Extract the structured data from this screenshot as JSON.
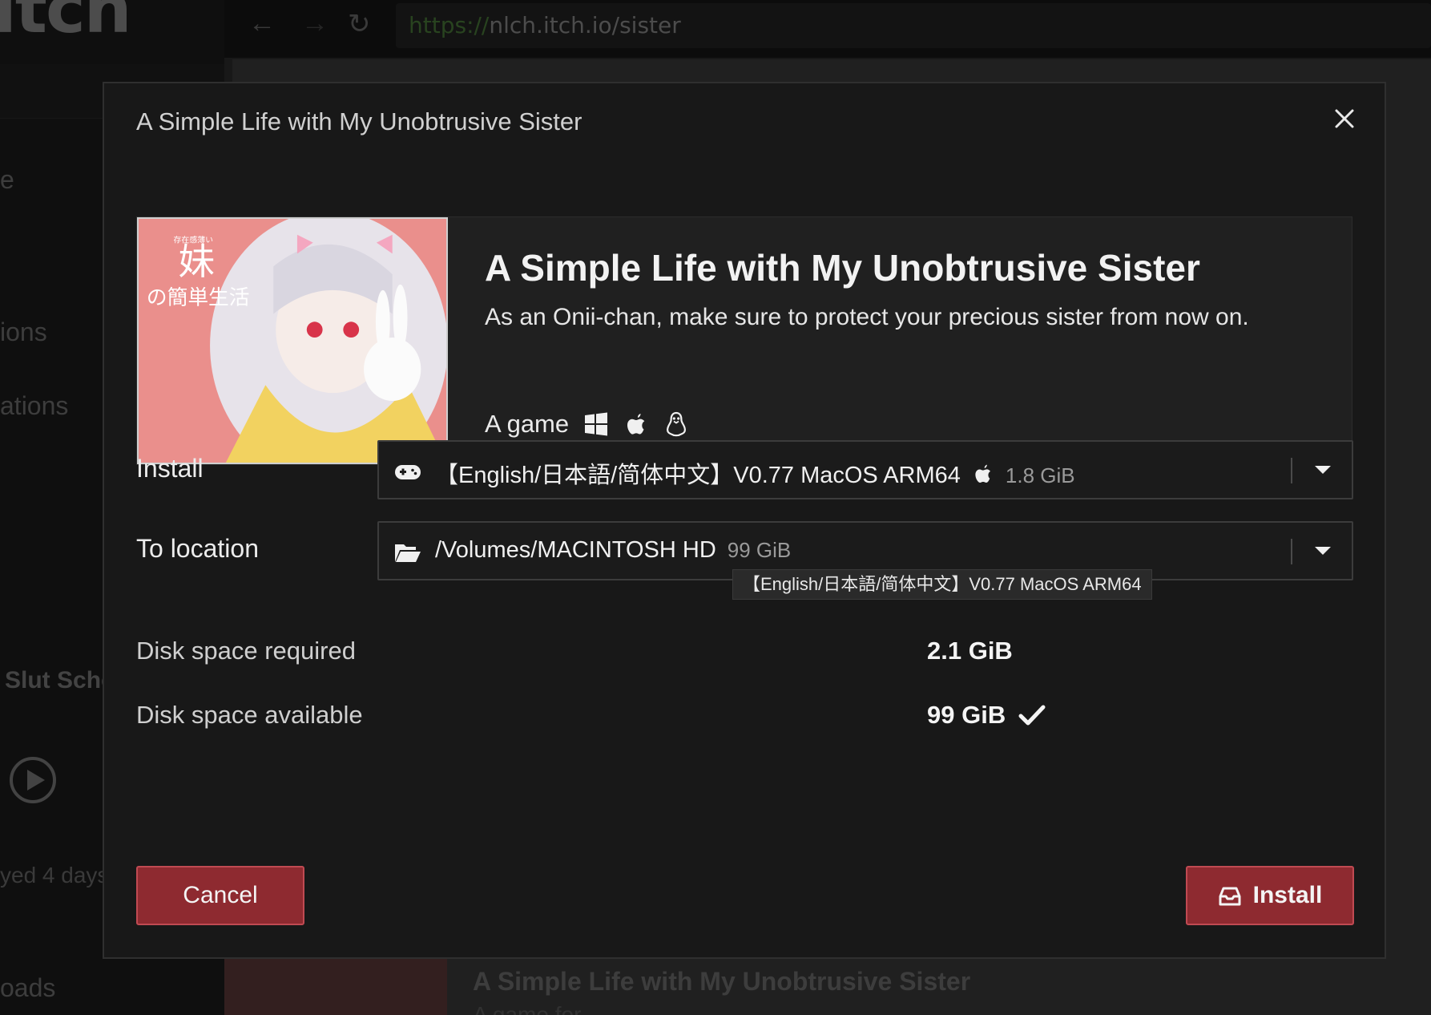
{
  "background": {
    "logo": "itch",
    "url_scheme": "https://",
    "url_rest": "nlch.itch.io/sister",
    "sidebar_items": [
      "e",
      "ions",
      "ations",
      "oads"
    ],
    "card_title": "Slut Scho",
    "card_subtitle": "yed 4 days",
    "bottom_title": "A Simple Life with My Unobtrusive Sister",
    "bottom_subtitle": "A game for"
  },
  "modal": {
    "title": "A Simple Life with My Unobtrusive Sister",
    "close_icon": "close-icon"
  },
  "game": {
    "name": "A Simple Life with My Unobtrusive Sister",
    "tagline": "As an Onii-chan, make sure to protect your precious sister from now on.",
    "kind": "A game",
    "platforms": [
      "windows-icon",
      "apple-icon",
      "linux-icon"
    ],
    "cover_text_main": "妹",
    "cover_text_sub": "の簡単生活",
    "cover_text_small": "存在感薄い"
  },
  "install": {
    "label": "Install",
    "selected_upload": "【English/日本語/简体中文】V0.77 MacOS ARM64",
    "upload_size": "1.8 GiB",
    "tooltip": "【English/日本語/简体中文】V0.77 MacOS ARM64"
  },
  "location": {
    "label": "To location",
    "path": "/Volumes/MACINTOSH HD",
    "free": "99 GiB"
  },
  "disk": {
    "required_label": "Disk space required",
    "required_value": "2.1 GiB",
    "available_label": "Disk space available",
    "available_value": "99 GiB"
  },
  "buttons": {
    "cancel": "Cancel",
    "install": "Install"
  },
  "colors": {
    "accent": "#8e2a30",
    "accent_border": "#c04a52",
    "modal_bg": "#181818"
  }
}
